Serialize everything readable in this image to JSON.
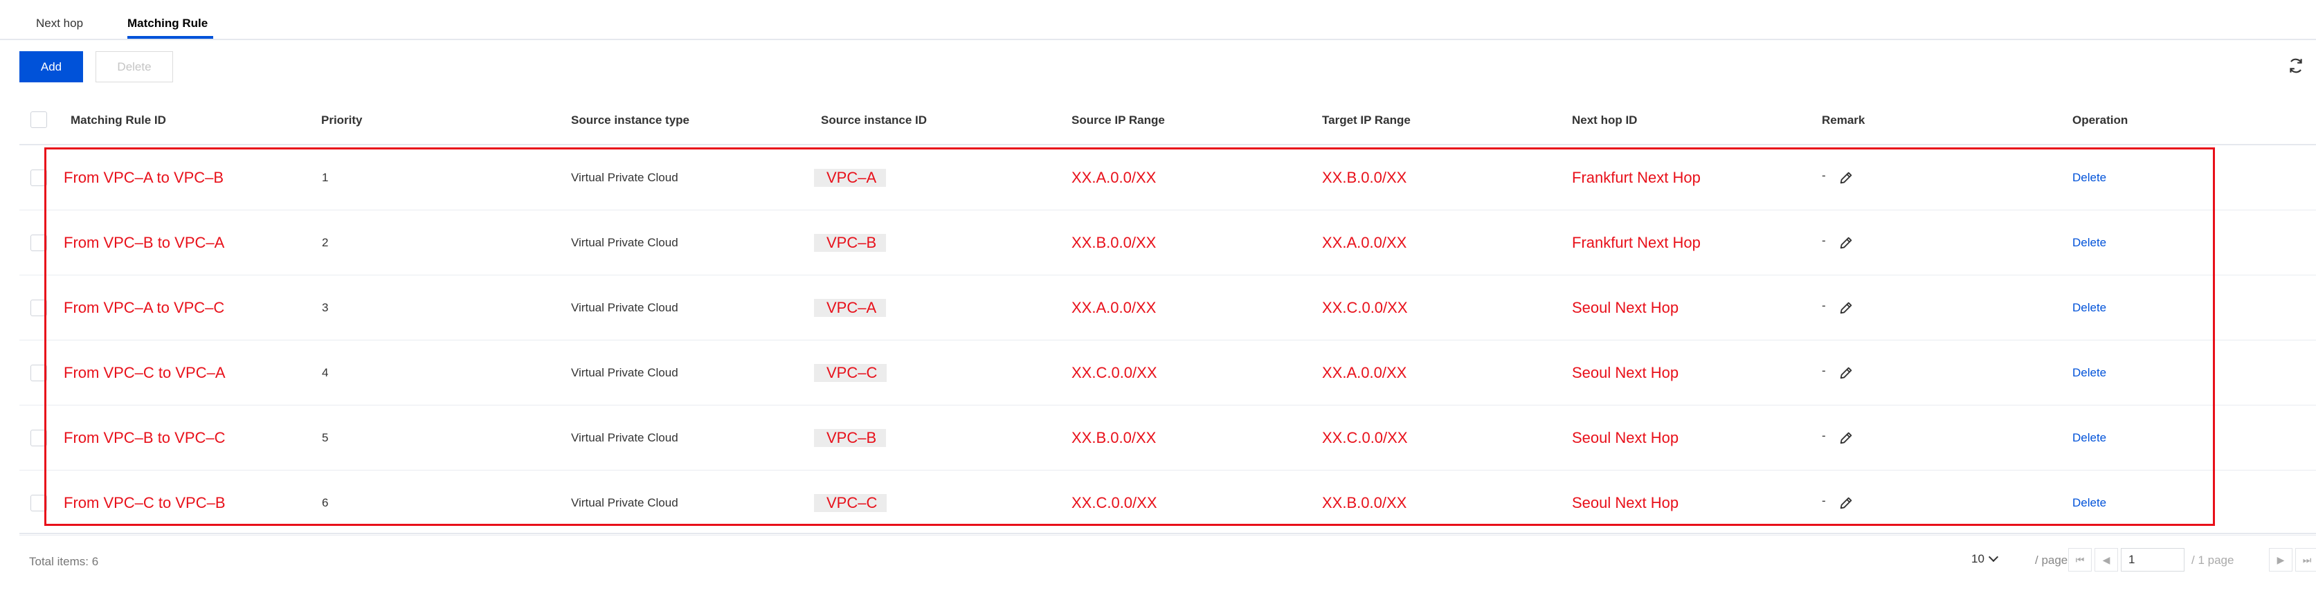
{
  "tabs": [
    {
      "label": "Next hop",
      "active": false
    },
    {
      "label": "Matching Rule",
      "active": true
    }
  ],
  "toolbar": {
    "add_label": "Add",
    "delete_label": "Delete"
  },
  "columns": {
    "rule_id": "Matching Rule ID",
    "priority": "Priority",
    "source_type": "Source instance type",
    "source_id": "Source instance ID",
    "source_ip": "Source IP Range",
    "target_ip": "Target IP Range",
    "next_hop": "Next hop ID",
    "remark": "Remark",
    "operation": "Operation"
  },
  "rows": [
    {
      "rule_id": "From VPC–A to VPC–B",
      "priority": "1",
      "source_type": "Virtual Private Cloud",
      "source_id": "VPC–A",
      "source_ip": "XX.A.0.0/XX",
      "target_ip": "XX.B.0.0/XX",
      "next_hop": "Frankfurt Next Hop",
      "remark": "-",
      "operation": "Delete"
    },
    {
      "rule_id": "From VPC–B to VPC–A",
      "priority": "2",
      "source_type": "Virtual Private Cloud",
      "source_id": "VPC–B",
      "source_ip": "XX.B.0.0/XX",
      "target_ip": "XX.A.0.0/XX",
      "next_hop": "Frankfurt Next Hop",
      "remark": "-",
      "operation": "Delete"
    },
    {
      "rule_id": "From VPC–A to VPC–C",
      "priority": "3",
      "source_type": "Virtual Private Cloud",
      "source_id": "VPC–A",
      "source_ip": "XX.A.0.0/XX",
      "target_ip": "XX.C.0.0/XX",
      "next_hop": "Seoul Next Hop",
      "remark": "-",
      "operation": "Delete"
    },
    {
      "rule_id": "From VPC–C to VPC–A",
      "priority": "4",
      "source_type": "Virtual Private Cloud",
      "source_id": "VPC–C",
      "source_ip": "XX.C.0.0/XX",
      "target_ip": "XX.A.0.0/XX",
      "next_hop": "Seoul Next Hop",
      "remark": "-",
      "operation": "Delete"
    },
    {
      "rule_id": "From VPC–B to VPC–C",
      "priority": "5",
      "source_type": "Virtual Private Cloud",
      "source_id": "VPC–B",
      "source_ip": "XX.B.0.0/XX",
      "target_ip": "XX.C.0.0/XX",
      "next_hop": "Seoul Next Hop",
      "remark": "-",
      "operation": "Delete"
    },
    {
      "rule_id": "From VPC–C to VPC–B",
      "priority": "6",
      "source_type": "Virtual Private Cloud",
      "source_id": "VPC–C",
      "source_ip": "XX.C.0.0/XX",
      "target_ip": "XX.B.0.0/XX",
      "next_hop": "Seoul Next Hop",
      "remark": "-",
      "operation": "Delete"
    }
  ],
  "footer": {
    "total": "Total items: 6",
    "page_size": "10",
    "per_page": "/ page",
    "page_value": "1",
    "pages_of": "/ 1 page"
  },
  "icons": {
    "refresh": "refresh-icon",
    "edit": "pencil-icon",
    "first": "first-page-icon",
    "prev": "prev-page-icon",
    "next": "next-page-icon",
    "last": "last-page-icon"
  },
  "colors": {
    "primary": "#0052d9",
    "annotation_red": "#e8101a"
  }
}
